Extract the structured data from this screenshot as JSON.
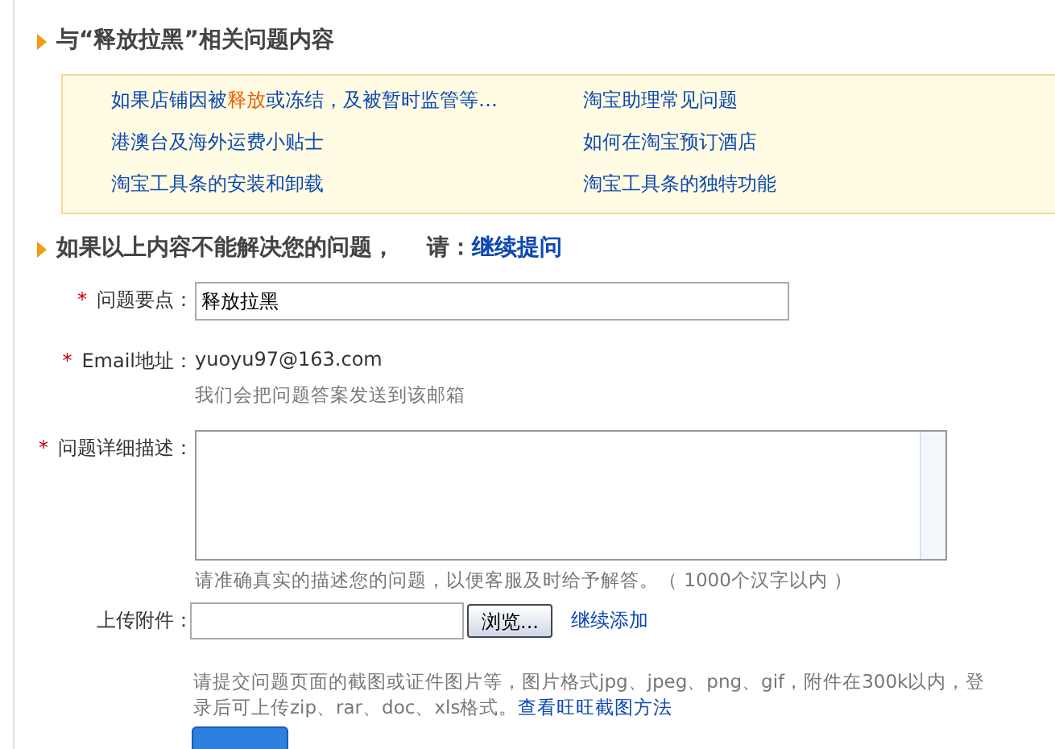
{
  "related": {
    "title": "与“释放拉黑”相关问题内容",
    "links": [
      {
        "parts": [
          {
            "text": "如果店铺因被",
            "highlight": false
          },
          {
            "text": "释放",
            "highlight": true
          },
          {
            "text": "或冻结，及被暂时监管等…",
            "highlight": false
          }
        ]
      },
      {
        "parts": [
          {
            "text": "淘宝助理常见问题",
            "highlight": false
          }
        ]
      },
      {
        "parts": [
          {
            "text": "港澳台及海外运费小贴士",
            "highlight": false
          }
        ]
      },
      {
        "parts": [
          {
            "text": "如何在淘宝预订酒店",
            "highlight": false
          }
        ]
      },
      {
        "parts": [
          {
            "text": "淘宝工具条的安装和卸载",
            "highlight": false
          }
        ]
      },
      {
        "parts": [
          {
            "text": "淘宝工具条的独特功能",
            "highlight": false
          }
        ]
      }
    ]
  },
  "ask": {
    "title": "如果以上内容不能解决您的问题，",
    "prompt": "请：",
    "link": "继续提问"
  },
  "form": [
    {
      "kind": "input",
      "marker": "*",
      "label": "问题要点：",
      "value": "释放拉黑"
    },
    {
      "kind": "text",
      "marker": "*",
      "label": "Email地址：",
      "value": "yuoyu97@163.com",
      "hint": "我们会把问题答案发送到该邮箱"
    },
    {
      "kind": "textarea",
      "marker": "*",
      "label": "问题详细描述：",
      "hint": "请准确真实的描述您的问题，以便客服及时给予解答。（ 1000个汉字以内 ）"
    },
    {
      "kind": "file",
      "label": "上传附件：",
      "button": "浏览...",
      "link": "继续添加",
      "hint": "请提交问题页面的截图或证件图片等，图片格式jpg、jpeg、png、gif，附件在300k以内，登录后可上传zip、rar、doc、xls格式。",
      "hint_link": "查看旺旺截图方法"
    }
  ]
}
